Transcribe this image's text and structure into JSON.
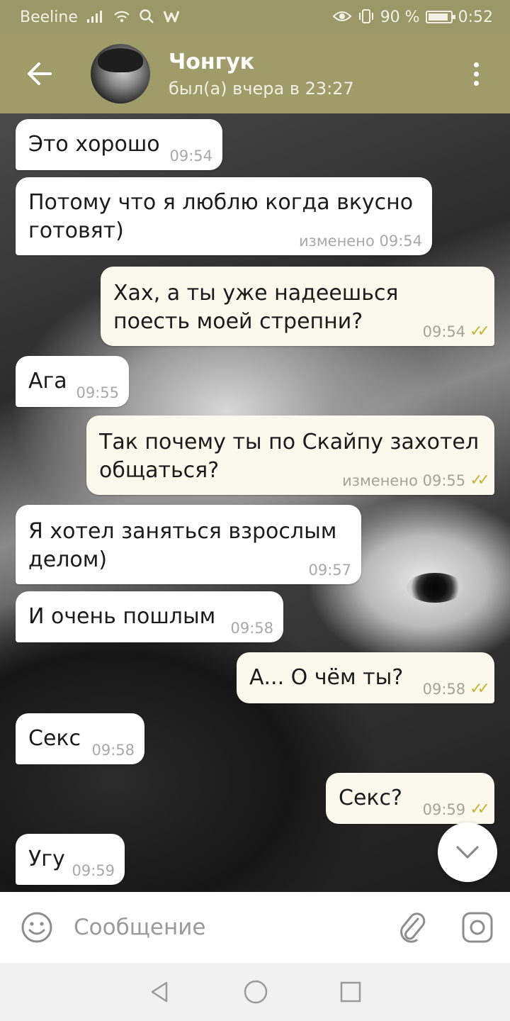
{
  "status_bar": {
    "carrier": "Beeline",
    "battery_percent": "90 %",
    "time": "0:52",
    "battery_level": 0.9
  },
  "header": {
    "contact_name": "Чонгук",
    "last_seen": "был(а) вчера в 23:27"
  },
  "messages": [
    {
      "dir": "in",
      "text": "Это хорошо",
      "time": "09:54"
    },
    {
      "dir": "in",
      "text": "Потому что я люблю когда вкусно готовят)",
      "time": "изменено 09:54"
    },
    {
      "dir": "out",
      "text": "Хах, а ты уже надеешься поесть моей стрепни?",
      "time": "09:54",
      "status": "read"
    },
    {
      "dir": "in",
      "text": "Ага",
      "time": "09:55"
    },
    {
      "dir": "out",
      "text": "Так почему ты по Скайпу захотел общаться?",
      "time": "изменено 09:55",
      "status": "read"
    },
    {
      "dir": "in",
      "text": "Я хотел заняться взрослым делом)",
      "time": "09:57"
    },
    {
      "dir": "in",
      "text": "И очень пошлым",
      "time": "09:58"
    },
    {
      "dir": "out",
      "text": "А... О чём ты?",
      "time": "09:58",
      "status": "read"
    },
    {
      "dir": "in",
      "text": "Секс",
      "time": "09:58"
    },
    {
      "dir": "out",
      "text": "Секс?",
      "time": "09:59",
      "status": "read"
    },
    {
      "dir": "in",
      "text": "Угу",
      "time": "09:59"
    }
  ],
  "composer": {
    "placeholder": "Сообщение"
  },
  "colors": {
    "header_bg": "#a09c6a",
    "incoming_bubble": "#ffffff",
    "outgoing_bubble": "#fbf8ec",
    "read_ticks": "#c8b23a"
  },
  "icons": {
    "back": "arrow-left-icon",
    "menu": "more-vertical-icon",
    "scroll_down": "chevron-down-icon",
    "emoji": "smiley-icon",
    "attach": "paperclip-icon",
    "camera": "camera-icon"
  }
}
